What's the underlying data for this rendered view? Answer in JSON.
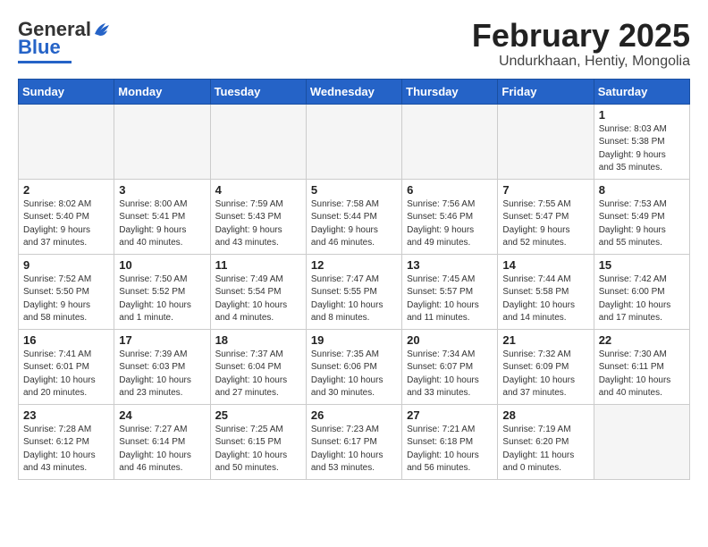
{
  "header": {
    "logo_general": "General",
    "logo_blue": "Blue",
    "month_title": "February 2025",
    "subtitle": "Undurkhaan, Hentiy, Mongolia"
  },
  "weekdays": [
    "Sunday",
    "Monday",
    "Tuesday",
    "Wednesday",
    "Thursday",
    "Friday",
    "Saturday"
  ],
  "weeks": [
    [
      {
        "day": "",
        "info": ""
      },
      {
        "day": "",
        "info": ""
      },
      {
        "day": "",
        "info": ""
      },
      {
        "day": "",
        "info": ""
      },
      {
        "day": "",
        "info": ""
      },
      {
        "day": "",
        "info": ""
      },
      {
        "day": "1",
        "info": "Sunrise: 8:03 AM\nSunset: 5:38 PM\nDaylight: 9 hours\nand 35 minutes."
      }
    ],
    [
      {
        "day": "2",
        "info": "Sunrise: 8:02 AM\nSunset: 5:40 PM\nDaylight: 9 hours\nand 37 minutes."
      },
      {
        "day": "3",
        "info": "Sunrise: 8:00 AM\nSunset: 5:41 PM\nDaylight: 9 hours\nand 40 minutes."
      },
      {
        "day": "4",
        "info": "Sunrise: 7:59 AM\nSunset: 5:43 PM\nDaylight: 9 hours\nand 43 minutes."
      },
      {
        "day": "5",
        "info": "Sunrise: 7:58 AM\nSunset: 5:44 PM\nDaylight: 9 hours\nand 46 minutes."
      },
      {
        "day": "6",
        "info": "Sunrise: 7:56 AM\nSunset: 5:46 PM\nDaylight: 9 hours\nand 49 minutes."
      },
      {
        "day": "7",
        "info": "Sunrise: 7:55 AM\nSunset: 5:47 PM\nDaylight: 9 hours\nand 52 minutes."
      },
      {
        "day": "8",
        "info": "Sunrise: 7:53 AM\nSunset: 5:49 PM\nDaylight: 9 hours\nand 55 minutes."
      }
    ],
    [
      {
        "day": "9",
        "info": "Sunrise: 7:52 AM\nSunset: 5:50 PM\nDaylight: 9 hours\nand 58 minutes."
      },
      {
        "day": "10",
        "info": "Sunrise: 7:50 AM\nSunset: 5:52 PM\nDaylight: 10 hours\nand 1 minute."
      },
      {
        "day": "11",
        "info": "Sunrise: 7:49 AM\nSunset: 5:54 PM\nDaylight: 10 hours\nand 4 minutes."
      },
      {
        "day": "12",
        "info": "Sunrise: 7:47 AM\nSunset: 5:55 PM\nDaylight: 10 hours\nand 8 minutes."
      },
      {
        "day": "13",
        "info": "Sunrise: 7:45 AM\nSunset: 5:57 PM\nDaylight: 10 hours\nand 11 minutes."
      },
      {
        "day": "14",
        "info": "Sunrise: 7:44 AM\nSunset: 5:58 PM\nDaylight: 10 hours\nand 14 minutes."
      },
      {
        "day": "15",
        "info": "Sunrise: 7:42 AM\nSunset: 6:00 PM\nDaylight: 10 hours\nand 17 minutes."
      }
    ],
    [
      {
        "day": "16",
        "info": "Sunrise: 7:41 AM\nSunset: 6:01 PM\nDaylight: 10 hours\nand 20 minutes."
      },
      {
        "day": "17",
        "info": "Sunrise: 7:39 AM\nSunset: 6:03 PM\nDaylight: 10 hours\nand 23 minutes."
      },
      {
        "day": "18",
        "info": "Sunrise: 7:37 AM\nSunset: 6:04 PM\nDaylight: 10 hours\nand 27 minutes."
      },
      {
        "day": "19",
        "info": "Sunrise: 7:35 AM\nSunset: 6:06 PM\nDaylight: 10 hours\nand 30 minutes."
      },
      {
        "day": "20",
        "info": "Sunrise: 7:34 AM\nSunset: 6:07 PM\nDaylight: 10 hours\nand 33 minutes."
      },
      {
        "day": "21",
        "info": "Sunrise: 7:32 AM\nSunset: 6:09 PM\nDaylight: 10 hours\nand 37 minutes."
      },
      {
        "day": "22",
        "info": "Sunrise: 7:30 AM\nSunset: 6:11 PM\nDaylight: 10 hours\nand 40 minutes."
      }
    ],
    [
      {
        "day": "23",
        "info": "Sunrise: 7:28 AM\nSunset: 6:12 PM\nDaylight: 10 hours\nand 43 minutes."
      },
      {
        "day": "24",
        "info": "Sunrise: 7:27 AM\nSunset: 6:14 PM\nDaylight: 10 hours\nand 46 minutes."
      },
      {
        "day": "25",
        "info": "Sunrise: 7:25 AM\nSunset: 6:15 PM\nDaylight: 10 hours\nand 50 minutes."
      },
      {
        "day": "26",
        "info": "Sunrise: 7:23 AM\nSunset: 6:17 PM\nDaylight: 10 hours\nand 53 minutes."
      },
      {
        "day": "27",
        "info": "Sunrise: 7:21 AM\nSunset: 6:18 PM\nDaylight: 10 hours\nand 56 minutes."
      },
      {
        "day": "28",
        "info": "Sunrise: 7:19 AM\nSunset: 6:20 PM\nDaylight: 11 hours\nand 0 minutes."
      },
      {
        "day": "",
        "info": ""
      }
    ]
  ]
}
